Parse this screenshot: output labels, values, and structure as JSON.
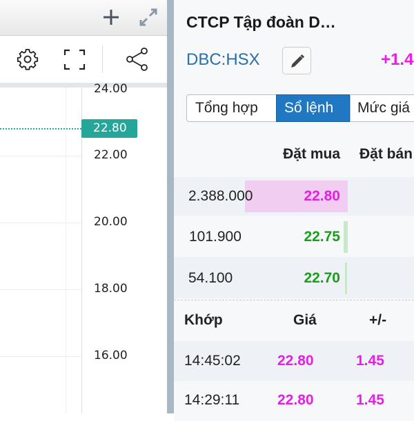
{
  "chart": {
    "price_axis": [
      "24.00",
      "22.00",
      "20.00",
      "18.00",
      "16.00"
    ],
    "last_price": "22.80",
    "last_price_color": "#26a69a"
  },
  "panel": {
    "title": "CTCP Tập đoàn D…",
    "symbol": "DBC:HSX",
    "change": "+1.4",
    "tabs": [
      {
        "label": "Tổng hợp",
        "active": false
      },
      {
        "label": "Sổ lệnh",
        "active": true
      },
      {
        "label": "Mức giá",
        "active": false
      }
    ],
    "orderbook": {
      "headers": {
        "bid": "Đặt mua",
        "ask": "Đặt bán"
      },
      "rows": [
        {
          "volume": "2.388.000",
          "price": "22.80"
        },
        {
          "volume": "101.900",
          "price": "22.75"
        },
        {
          "volume": "54.100",
          "price": "22.70"
        }
      ]
    },
    "matches": {
      "headers": {
        "time": "Khớp",
        "price": "Giá",
        "change": "+/-"
      },
      "rows": [
        {
          "time": "14:45:02",
          "price": "22.80",
          "change": "1.45"
        },
        {
          "time": "14:29:11",
          "price": "22.80",
          "change": "1.45"
        }
      ]
    }
  },
  "colors": {
    "up": "#e61ee6",
    "green": "#1a9e1a",
    "accent": "#1f78c1",
    "symbol": "#2a6fa8"
  }
}
